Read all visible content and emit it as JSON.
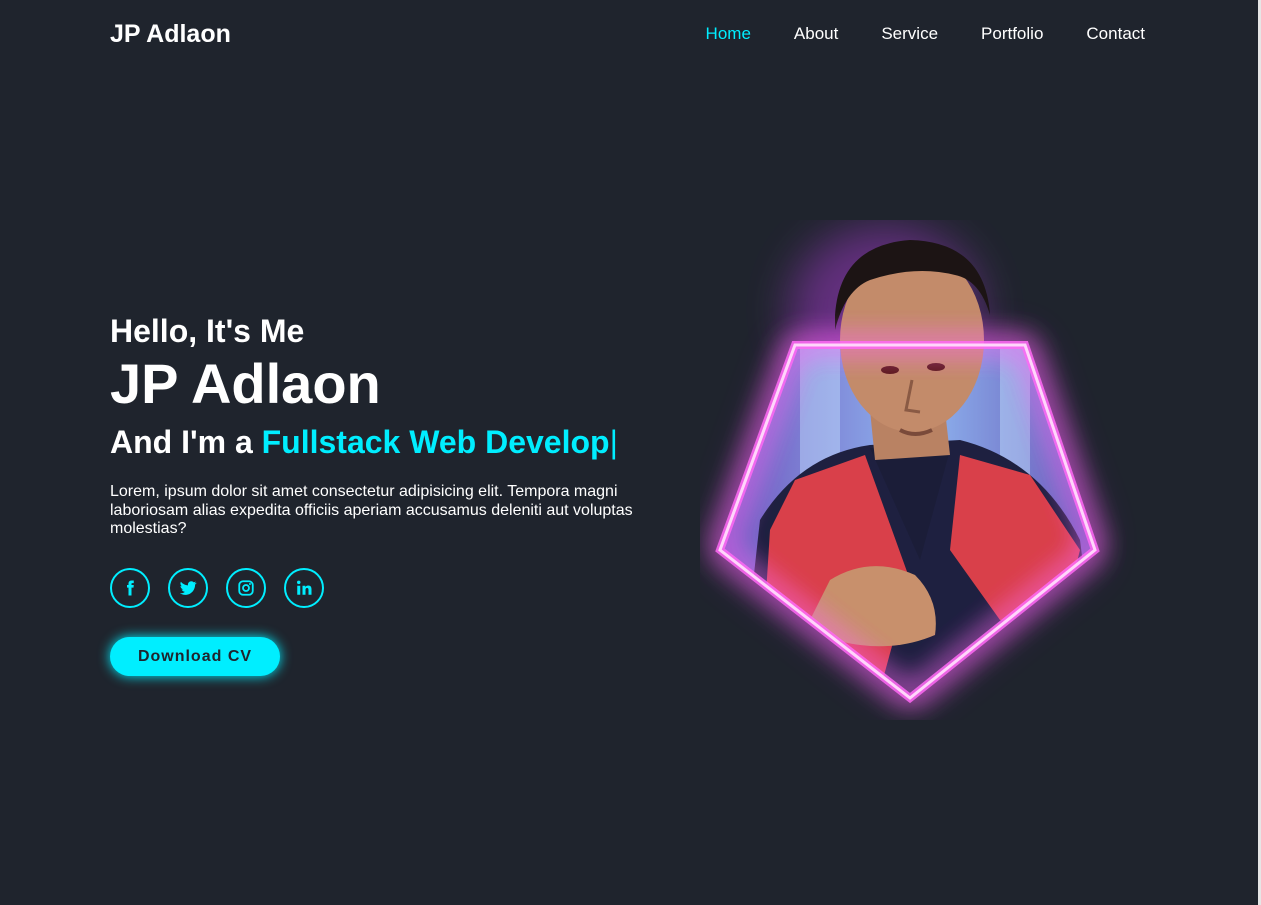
{
  "header": {
    "logo": "JP Adlaon",
    "nav": [
      {
        "label": "Home",
        "active": true
      },
      {
        "label": "About",
        "active": false
      },
      {
        "label": "Service",
        "active": false
      },
      {
        "label": "Portfolio",
        "active": false
      },
      {
        "label": "Contact",
        "active": false
      }
    ]
  },
  "hero": {
    "greeting": "Hello, It's Me",
    "name": "JP Adlaon",
    "role_prefix": "And I'm a ",
    "role_typed": "Fullstack Web Develop",
    "role_cursor": "|",
    "description": "Lorem, ipsum dolor sit amet consectetur adipisicing elit. Tempora magni laboriosam alias expedita officiis aperiam accusamus deleniti aut voluptas molestias?",
    "social_icons": [
      "facebook-icon",
      "twitter-icon",
      "instagram-icon",
      "linkedin-icon"
    ],
    "download_button": "Download CV"
  },
  "colors": {
    "background": "#1f242d",
    "accent": "#00eeff",
    "text": "#ffffff",
    "neon": "#d94cff"
  }
}
